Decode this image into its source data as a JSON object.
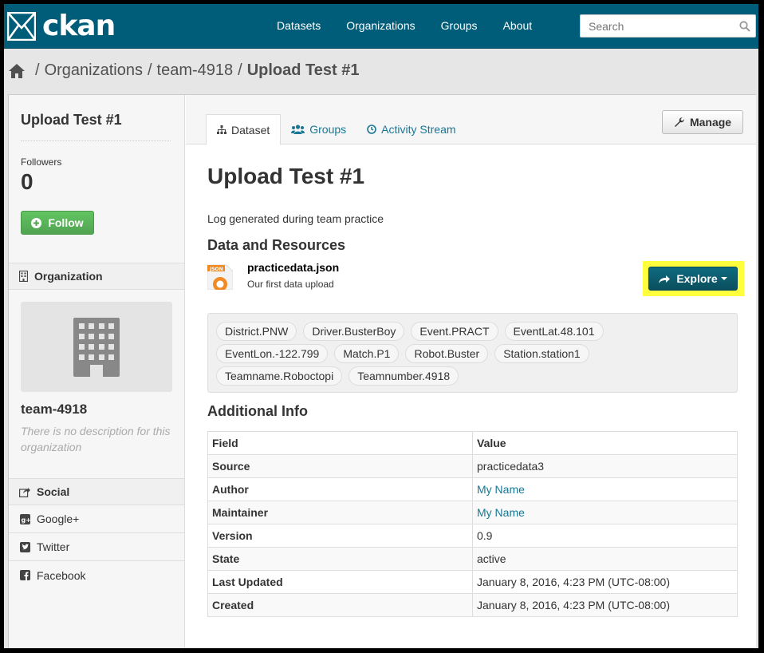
{
  "header": {
    "logo_text": "ckan",
    "nav": [
      "Datasets",
      "Organizations",
      "Groups",
      "About"
    ],
    "search_placeholder": "Search"
  },
  "breadcrumb": {
    "items": [
      "Organizations",
      "team-4918"
    ],
    "current": "Upload Test #1"
  },
  "sidebar": {
    "title": "Upload Test #1",
    "followers_label": "Followers",
    "followers_count": "0",
    "follow_label": "Follow",
    "organization_heading": "Organization",
    "org_name": "team-4918",
    "org_description": "There is no description for this organization",
    "social_heading": "Social",
    "social_links": [
      "Google+",
      "Twitter",
      "Facebook"
    ]
  },
  "tabs": {
    "dataset": "Dataset",
    "groups": "Groups",
    "activity": "Activity Stream"
  },
  "manage_label": "Manage",
  "dataset": {
    "title": "Upload Test #1",
    "notes": "Log generated during team practice"
  },
  "resources": {
    "heading": "Data and Resources",
    "items": [
      {
        "format": "JSON",
        "name": "practicedata.json",
        "description": "Our first data upload",
        "explore_label": "Explore"
      }
    ]
  },
  "tags": [
    [
      "District.PNW",
      "Driver.BusterBoy",
      "Event.PRACT",
      "EventLat.48.101"
    ],
    [
      "EventLon.-122.799",
      "Match.P1",
      "Robot.Buster",
      "Station.station1"
    ],
    [
      "Teamname.Roboctopi",
      "Teamnumber.4918"
    ]
  ],
  "additional_info": {
    "heading": "Additional Info",
    "columns": [
      "Field",
      "Value"
    ],
    "rows": [
      {
        "field": "Source",
        "value": "practicedata3",
        "link": false
      },
      {
        "field": "Author",
        "value": "My Name",
        "link": true
      },
      {
        "field": "Maintainer",
        "value": "My Name",
        "link": true
      },
      {
        "field": "Version",
        "value": "0.9",
        "link": false
      },
      {
        "field": "State",
        "value": "active",
        "link": false
      },
      {
        "field": "Last Updated",
        "value": "January 8, 2016, 4:23 PM (UTC-08:00)",
        "link": false
      },
      {
        "field": "Created",
        "value": "January 8, 2016, 4:23 PM (UTC-08:00)",
        "link": false
      }
    ]
  },
  "colors": {
    "header_bg": "#005d7a",
    "link": "#187794",
    "follow_green": "#5cb85c",
    "explore_bg": "#0a4f5e",
    "highlight": "#ffff3d"
  }
}
